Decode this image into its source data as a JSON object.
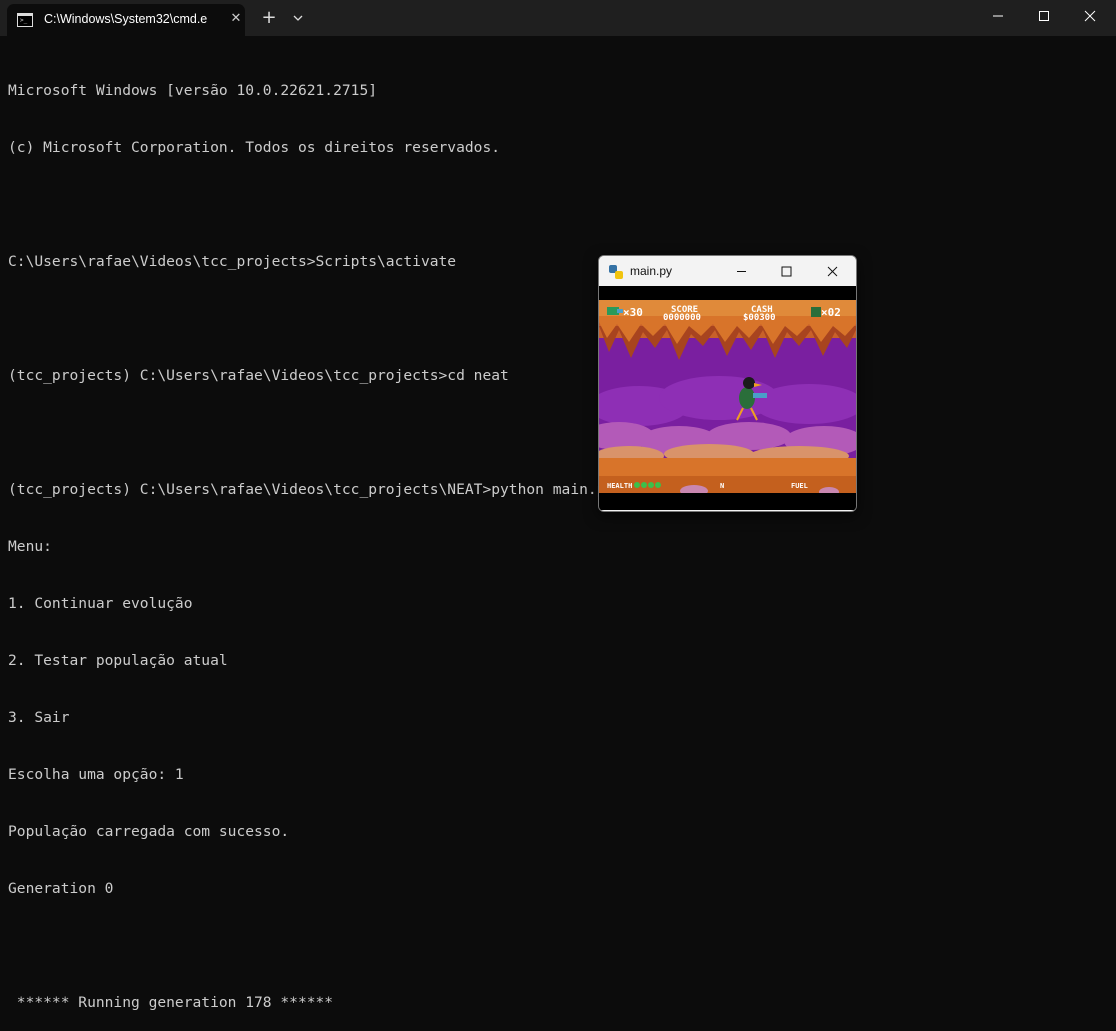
{
  "terminal": {
    "tab_title": "C:\\Windows\\System32\\cmd.e",
    "new_tab_symbol": "+",
    "lines": [
      "Microsoft Windows [versão 10.0.22621.2715]",
      "(c) Microsoft Corporation. Todos os direitos reservados.",
      "",
      "C:\\Users\\rafae\\Videos\\tcc_projects>Scripts\\activate",
      "",
      "(tcc_projects) C:\\Users\\rafae\\Videos\\tcc_projects>cd neat",
      "",
      "(tcc_projects) C:\\Users\\rafae\\Videos\\tcc_projects\\NEAT>python main.py",
      "Menu:",
      "1. Continuar evolução",
      "2. Testar população atual",
      "3. Sair",
      "Escolha uma opção: 1",
      "População carregada com sucesso.",
      "Generation 0",
      "",
      " ****** Running generation 178 ******"
    ]
  },
  "game_window": {
    "title": "main.py",
    "hud": {
      "lives": "×30",
      "score_label": "SCORE",
      "score_value": "0000000",
      "cash_label": "CASH",
      "cash_value": "$00300",
      "extra": "×02",
      "health_label": "HEALTH",
      "n_label": "N",
      "fuel_label": "FUEL"
    }
  },
  "colors": {
    "terminal_bg": "#0c0c0c",
    "terminal_text": "#cccccc",
    "cave_purple": "#7a1fa0",
    "rock_orange": "#d8742a"
  }
}
